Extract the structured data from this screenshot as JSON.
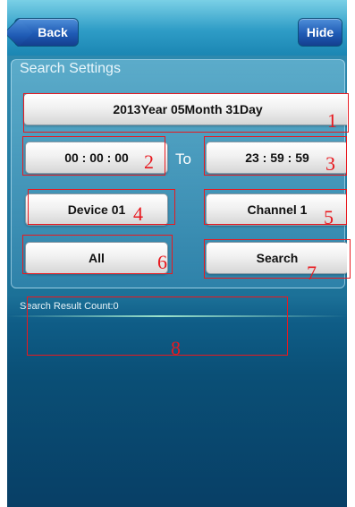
{
  "nav": {
    "back_label": "Back",
    "hide_label": "Hide"
  },
  "panel": {
    "title": "Search Settings",
    "date": "2013Year 05Month 31Day",
    "start_time": "00 : 00 : 00",
    "to_label": "To",
    "end_time": "23 : 59 : 59",
    "device": "Device 01",
    "channel": "Channel 1",
    "type": "All",
    "search_label": "Search"
  },
  "result": {
    "count_text": "Search Result Count:0"
  },
  "annotations": [
    "1",
    "2",
    "3",
    "4",
    "5",
    "6",
    "7",
    "8"
  ],
  "colors": {
    "annotation": "#e8191f",
    "nav_button": "#1f5bb5",
    "background": "#0f5d87"
  }
}
